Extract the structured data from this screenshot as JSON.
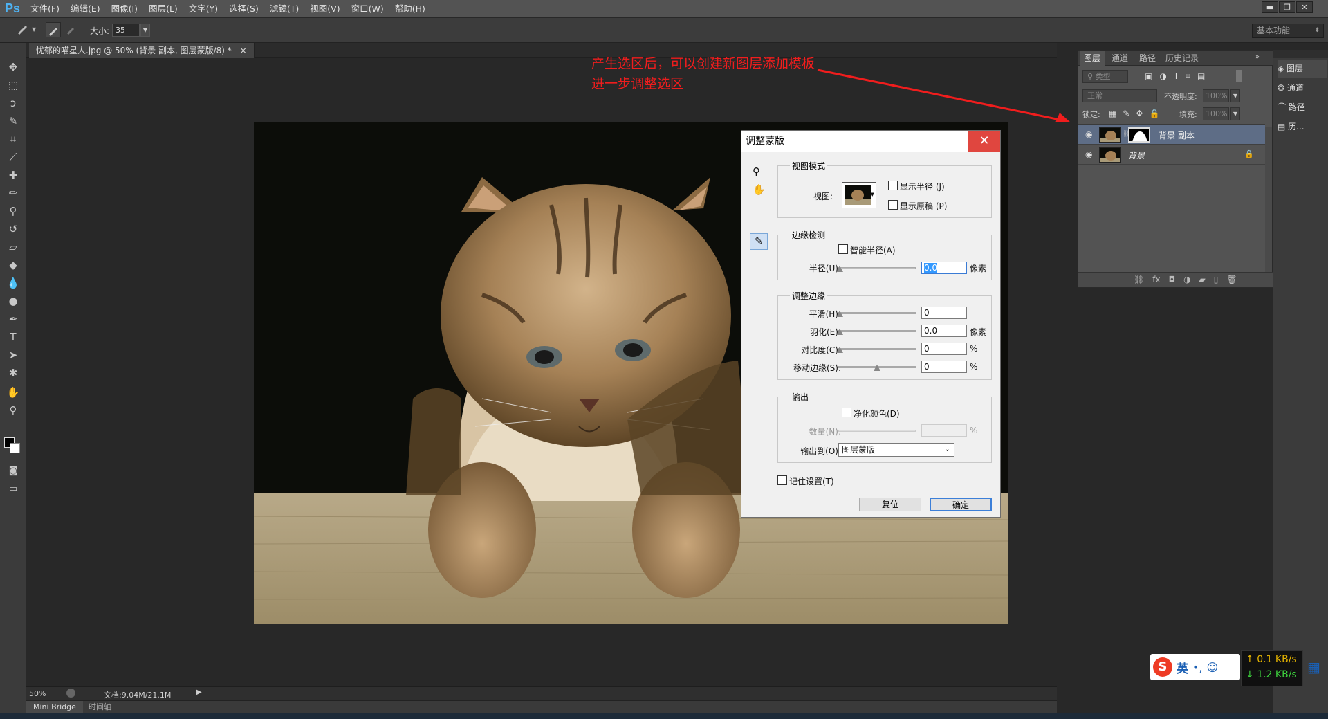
{
  "app": {
    "logo": "Ps",
    "workspace": "基本功能"
  },
  "menu": [
    "文件(F)",
    "编辑(E)",
    "图像(I)",
    "图层(L)",
    "文字(Y)",
    "选择(S)",
    "滤镜(T)",
    "视图(V)",
    "窗口(W)",
    "帮助(H)"
  ],
  "window_controls": {
    "minimize": "▬",
    "restore": "❐",
    "close": "✕"
  },
  "options": {
    "size_label": "大小:",
    "size_value": "35"
  },
  "document": {
    "tab": "忧郁的喵星人.jpg @ 50% (背景 副本, 图层蒙版/8) *",
    "tab_close": "×"
  },
  "annotation": {
    "line1": "产生选区后，可以创建新图层添加模板",
    "line2": "进一步调整选区"
  },
  "status": {
    "zoom": "50%",
    "doc": "文档:9.04M/21.1M"
  },
  "bottom_tabs": [
    "Mini Bridge",
    "时间轴"
  ],
  "layers_panel": {
    "tabs": [
      "图层",
      "通道",
      "路径",
      "历史记录"
    ],
    "filter": "类型",
    "blend_mode": "正常",
    "opacity_label": "不透明度:",
    "opacity": "100%",
    "lock_label": "锁定:",
    "fill_label": "填充:",
    "fill": "100%",
    "layers": [
      {
        "name": "背景 副本"
      },
      {
        "name": "背景"
      }
    ],
    "footer_icons": [
      "link-icon",
      "fx-icon",
      "mask-icon",
      "adjust-icon",
      "folder-icon",
      "new-layer-icon",
      "trash-icon"
    ]
  },
  "side_panel": [
    "图层",
    "通道",
    "路径",
    "历..."
  ],
  "dialog": {
    "title": "调整蒙版",
    "close": "✕",
    "view_mode": {
      "title": "视图模式",
      "view_label": "视图:",
      "show_radius": "显示半径 (J)",
      "show_original": "显示原稿 (P)"
    },
    "edge_detection": {
      "title": "边缘检测",
      "smart_radius": "智能半径(A)",
      "radius_label": "半径(U):",
      "radius_value": "0.0",
      "radius_unit": "像素"
    },
    "adjust_edge": {
      "title": "调整边缘",
      "smooth_label": "平滑(H):",
      "smooth_value": "0",
      "feather_label": "羽化(E):",
      "feather_value": "0.0",
      "feather_unit": "像素",
      "contrast_label": "对比度(C):",
      "contrast_value": "0",
      "contrast_unit": "%",
      "shift_label": "移动边缘(S):",
      "shift_value": "0",
      "shift_unit": "%"
    },
    "output": {
      "title": "输出",
      "decontaminate": "净化颜色(D)",
      "amount_label": "数量(N):",
      "amount_unit": "%",
      "output_to_label": "输出到(O):",
      "output_to": "图层蒙版"
    },
    "remember": "记住设置(T)",
    "reset": "复位",
    "ok": "确定"
  },
  "ime": {
    "label": "英"
  },
  "net": {
    "up": "0.1 KB/s",
    "down": "1.2 KB/s"
  }
}
